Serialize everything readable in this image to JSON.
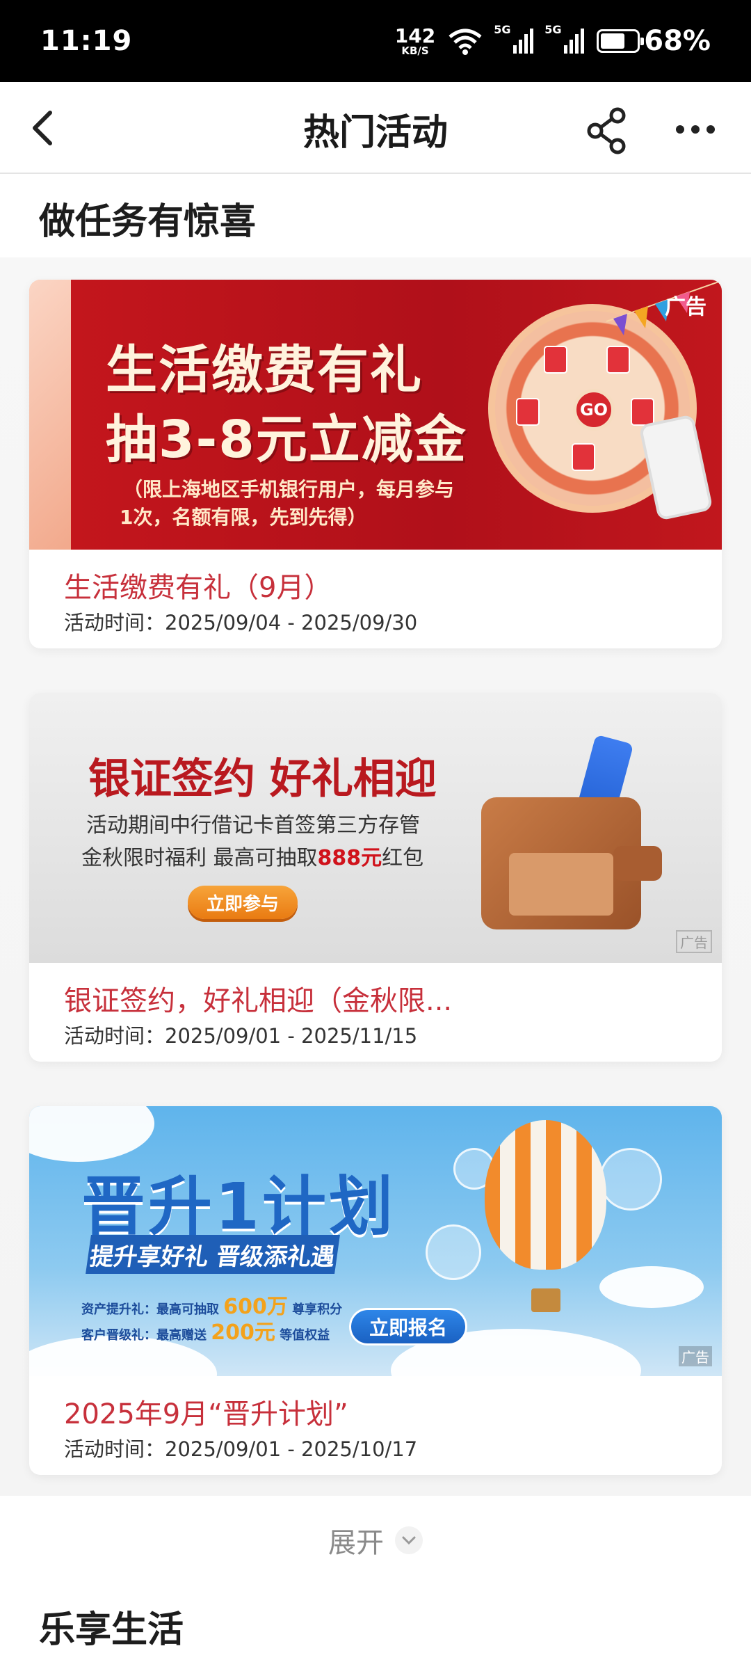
{
  "status_bar": {
    "time": "11:19",
    "net_speed": "142",
    "net_unit": "KB/S",
    "sig1_tag": "5G",
    "sig2_tag": "5G",
    "battery": "68%",
    "battery_level": 0.68
  },
  "header": {
    "title": "热门活动"
  },
  "section1": {
    "title": "做任务有惊喜"
  },
  "cards": [
    {
      "banner_line1": "生活缴费有礼",
      "banner_line2": "抽3-8元立减金",
      "banner_sub1": "（限上海地区手机银行用户，每月参与",
      "banner_sub2": "1次，名额有限，先到先得）",
      "wheel_label": "GO",
      "ad_label": "广告",
      "title": "生活缴费有礼（9月）",
      "time": "活动时间：2025/09/04 - 2025/09/30"
    },
    {
      "banner_line1": "银证签约 好礼相迎",
      "banner_line2": "活动期间中行借记卡首签第三方存管",
      "banner_line3_pre": "金秋限时福利 最高可抽取",
      "banner_line3_hl": "888元",
      "banner_line3_post": "红包",
      "banner_cta": "立即参与",
      "ad_label": "广告",
      "title": "银证签约，好礼相迎（金秋限...",
      "time": "活动时间：2025/09/01 - 2025/11/15"
    },
    {
      "banner_line1": "晋升1计划",
      "banner_ribbon": "提升享好礼 晋级添礼遇",
      "banner_row1_pre": "资产提升礼：最高可抽取",
      "banner_row1_big": "600万",
      "banner_row1_post": "尊享积分",
      "banner_row2_pre": "客户晋级礼：最高赠送",
      "banner_row2_big": "200元",
      "banner_row2_post": "等值权益",
      "banner_cta": "立即报名",
      "ad_label": "广告",
      "title": "2025年9月“晋升计划”",
      "time": "活动时间：2025/09/01 - 2025/10/17"
    }
  ],
  "expand": {
    "label": "展开"
  },
  "section2": {
    "title": "乐享生活"
  },
  "colors": {
    "accent_red": "#c7303b",
    "status_bar": "#000000"
  }
}
